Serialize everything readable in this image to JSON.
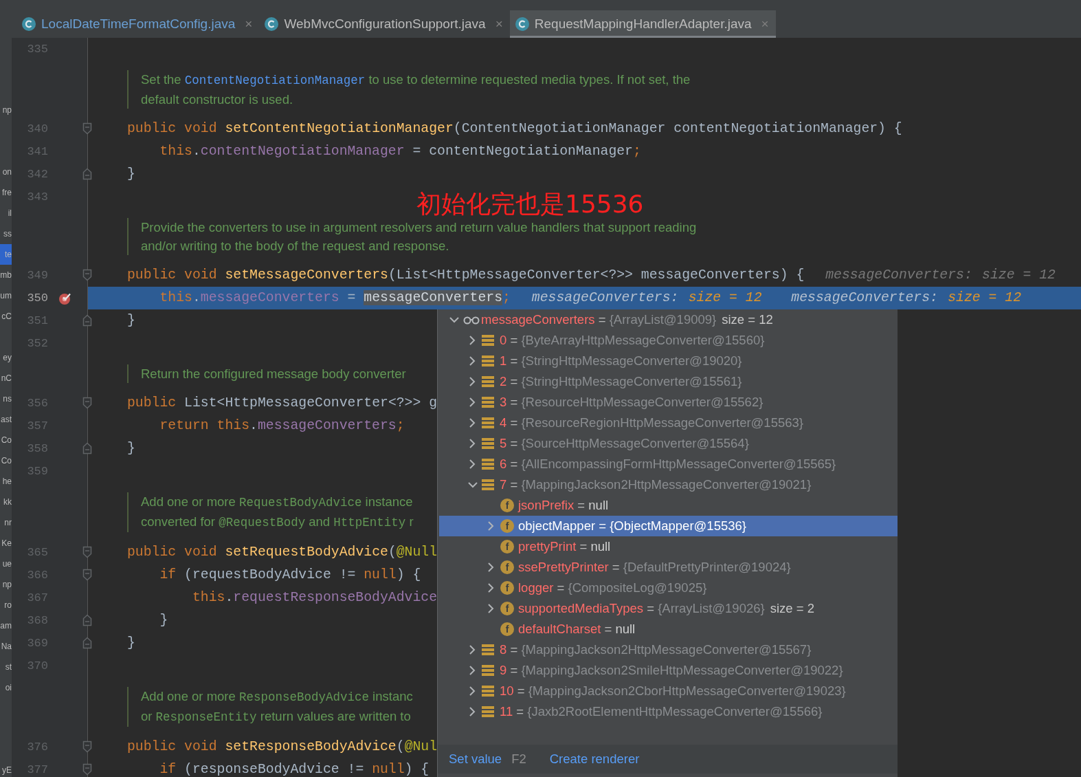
{
  "tabs": [
    {
      "label": "LocalDateTimeFormatConfig.java",
      "close": "×",
      "selected": false,
      "modified": true
    },
    {
      "label": "WebMvcConfigurationSupport.java",
      "close": "×",
      "selected": false,
      "modified": false
    },
    {
      "label": "RequestMappingHandlerAdapter.java",
      "close": "×",
      "selected": true,
      "modified": false
    }
  ],
  "project_panel": [
    {
      "kind": "spacer"
    },
    {
      "kind": "spacer"
    },
    {
      "kind": "spacer"
    },
    {
      "kind": "text",
      "text": "np",
      "selected": false
    },
    {
      "kind": "spacer"
    },
    {
      "kind": "spacer"
    },
    {
      "kind": "text",
      "text": "on",
      "selected": false
    },
    {
      "kind": "text",
      "text": "fre",
      "selected": false
    },
    {
      "kind": "text",
      "text": "il",
      "selected": false
    },
    {
      "kind": "text",
      "text": "ss",
      "selected": false
    },
    {
      "kind": "text",
      "text": "te",
      "selected": true
    },
    {
      "kind": "text",
      "text": "mb",
      "selected": false
    },
    {
      "kind": "text",
      "text": "um",
      "selected": false
    },
    {
      "kind": "text",
      "text": "cC",
      "selected": false
    },
    {
      "kind": "spacer"
    },
    {
      "kind": "text",
      "text": "ey",
      "selected": false
    },
    {
      "kind": "text",
      "text": "nC",
      "selected": false
    },
    {
      "kind": "text",
      "text": "ns",
      "selected": false
    },
    {
      "kind": "text",
      "text": "ast",
      "selected": false
    },
    {
      "kind": "text",
      "text": "Co",
      "selected": false
    },
    {
      "kind": "text",
      "text": "Co",
      "selected": false
    },
    {
      "kind": "text",
      "text": "he",
      "selected": false
    },
    {
      "kind": "text",
      "text": "kk",
      "selected": false
    },
    {
      "kind": "text",
      "text": "nr",
      "selected": false
    },
    {
      "kind": "text",
      "text": "Ke",
      "selected": false
    },
    {
      "kind": "text",
      "text": "ue",
      "selected": false
    },
    {
      "kind": "text",
      "text": "np",
      "selected": false
    },
    {
      "kind": "text",
      "text": "ro",
      "selected": false
    },
    {
      "kind": "text",
      "text": "am",
      "selected": false
    },
    {
      "kind": "text",
      "text": "Na",
      "selected": false
    },
    {
      "kind": "text",
      "text": "st",
      "selected": false
    },
    {
      "kind": "text",
      "text": "oi",
      "selected": false
    },
    {
      "kind": "spacer"
    },
    {
      "kind": "spacer"
    },
    {
      "kind": "spacer"
    },
    {
      "kind": "text",
      "text": "yE",
      "selected": false
    }
  ],
  "editor": {
    "annotation": "初始化完也是15536",
    "lines": [
      {
        "kind": "code",
        "number": "335",
        "fold_start": false,
        "fold_end": false,
        "current": false,
        "breakpoint": false
      },
      {
        "kind": "doc",
        "lines": [
          {
            "segments": [
              {
                "text": "Set the ",
                "kind": "text"
              },
              {
                "text": "ContentNegotiationManager",
                "kind": "link"
              },
              {
                "text": " to use to determine requested media types. If not set, the",
                "kind": "text"
              }
            ]
          },
          {
            "segments": [
              {
                "text": "default constructor is used.",
                "kind": "text"
              }
            ]
          }
        ]
      },
      {
        "kind": "code",
        "number": "340",
        "fold_start": true,
        "fold_end": false,
        "current": false,
        "breakpoint": false,
        "tokens": [
          {
            "text": "public void ",
            "kind": "keyword"
          },
          {
            "text": "setContentNegotiationManager",
            "kind": "method"
          },
          {
            "text": "(ContentNegotiationManager contentNegotiationManager) {",
            "kind": "plain"
          }
        ]
      },
      {
        "kind": "code",
        "number": "341",
        "fold_start": false,
        "fold_end": false,
        "current": false,
        "breakpoint": false,
        "tokens": [
          {
            "text": "    this",
            "kind": "keyword"
          },
          {
            "text": ".",
            "kind": "plain"
          },
          {
            "text": "contentNegotiationManager",
            "kind": "field"
          },
          {
            "text": " = contentNegotiationManager",
            "kind": "plain"
          },
          {
            "text": ";",
            "kind": "keyword"
          }
        ]
      },
      {
        "kind": "code",
        "number": "342",
        "fold_start": false,
        "fold_end": true,
        "current": false,
        "breakpoint": false,
        "tokens": [
          {
            "text": "}",
            "kind": "plain"
          }
        ]
      },
      {
        "kind": "code",
        "number": "343",
        "fold_start": false,
        "fold_end": false,
        "current": false,
        "breakpoint": false
      },
      {
        "kind": "doc",
        "lines": [
          {
            "segments": [
              {
                "text": "Provide the converters to use in argument resolvers and return value handlers that support reading",
                "kind": "text"
              }
            ]
          },
          {
            "segments": [
              {
                "text": "and/or writing to the body of the request and response.",
                "kind": "text"
              }
            ]
          }
        ]
      },
      {
        "kind": "code",
        "number": "349",
        "fold_start": true,
        "fold_end": false,
        "current": false,
        "breakpoint": false,
        "tokens": [
          {
            "text": "public void ",
            "kind": "keyword"
          },
          {
            "text": "setMessageConverters",
            "kind": "method"
          },
          {
            "text": "(List<HttpMessageConverter<?>> messageConverters) {",
            "kind": "plain"
          }
        ],
        "hints": [
          {
            "label": "messageConverters:",
            "value": "size = 12"
          }
        ]
      },
      {
        "kind": "code",
        "number": "350",
        "fold_start": false,
        "fold_end": false,
        "current": true,
        "breakpoint": true,
        "tokens": [
          {
            "text": "    this",
            "kind": "keyword"
          },
          {
            "text": ".",
            "kind": "plain"
          },
          {
            "text": "messageConverters",
            "kind": "field"
          },
          {
            "text": " = ",
            "kind": "plain"
          },
          {
            "text": "messageConverters",
            "kind": "selection"
          },
          {
            "text": ";",
            "kind": "keyword"
          }
        ],
        "hints": [
          {
            "label": "messageConverters:",
            "value": "size = 12"
          },
          {
            "label": "messageConverters:",
            "value": "size = 12"
          }
        ]
      },
      {
        "kind": "code",
        "number": "351",
        "fold_start": false,
        "fold_end": true,
        "current": false,
        "breakpoint": false,
        "tokens": [
          {
            "text": "}",
            "kind": "plain"
          }
        ]
      },
      {
        "kind": "code",
        "number": "352",
        "fold_start": false,
        "fold_end": false,
        "current": false,
        "breakpoint": false
      },
      {
        "kind": "doc",
        "lines": [
          {
            "segments": [
              {
                "text": "Return the configured message body converter",
                "kind": "text"
              }
            ]
          }
        ]
      },
      {
        "kind": "code",
        "number": "356",
        "fold_start": true,
        "fold_end": false,
        "current": false,
        "breakpoint": false,
        "tokens": [
          {
            "text": "public ",
            "kind": "keyword"
          },
          {
            "text": "List<HttpMessageConverter<?>> g",
            "kind": "plain"
          }
        ]
      },
      {
        "kind": "code",
        "number": "357",
        "fold_start": false,
        "fold_end": false,
        "current": false,
        "breakpoint": false,
        "tokens": [
          {
            "text": "    return this",
            "kind": "keyword"
          },
          {
            "text": ".",
            "kind": "plain"
          },
          {
            "text": "messageConverters",
            "kind": "field"
          },
          {
            "text": ";",
            "kind": "keyword"
          }
        ]
      },
      {
        "kind": "code",
        "number": "358",
        "fold_start": false,
        "fold_end": true,
        "current": false,
        "breakpoint": false,
        "tokens": [
          {
            "text": "}",
            "kind": "plain"
          }
        ]
      },
      {
        "kind": "code",
        "number": "359",
        "fold_start": false,
        "fold_end": false,
        "current": false,
        "breakpoint": false
      },
      {
        "kind": "doc",
        "lines": [
          {
            "segments": [
              {
                "text": "Add one or more ",
                "kind": "text"
              },
              {
                "text": "RequestBodyAdvice",
                "kind": "code"
              },
              {
                "text": " instance",
                "kind": "text"
              }
            ]
          },
          {
            "segments": [
              {
                "text": "converted for ",
                "kind": "text"
              },
              {
                "text": "@RequestBody",
                "kind": "code"
              },
              {
                "text": " and ",
                "kind": "text"
              },
              {
                "text": "HttpEntity",
                "kind": "code"
              },
              {
                "text": " r",
                "kind": "text"
              }
            ]
          }
        ]
      },
      {
        "kind": "code",
        "number": "365",
        "fold_start": true,
        "fold_end": false,
        "current": false,
        "breakpoint": false,
        "tokens": [
          {
            "text": "public void ",
            "kind": "keyword"
          },
          {
            "text": "setRequestBodyAdvice",
            "kind": "method"
          },
          {
            "text": "(",
            "kind": "plain"
          },
          {
            "text": "@Null",
            "kind": "annotation"
          }
        ]
      },
      {
        "kind": "code",
        "number": "366",
        "fold_start": true,
        "fold_end": false,
        "current": false,
        "breakpoint": false,
        "tokens": [
          {
            "text": "    if ",
            "kind": "keyword"
          },
          {
            "text": "(requestBodyAdvice != ",
            "kind": "plain"
          },
          {
            "text": "null",
            "kind": "keyword"
          },
          {
            "text": ") {",
            "kind": "plain"
          }
        ]
      },
      {
        "kind": "code",
        "number": "367",
        "fold_start": false,
        "fold_end": false,
        "current": false,
        "breakpoint": false,
        "tokens": [
          {
            "text": "        this",
            "kind": "keyword"
          },
          {
            "text": ".",
            "kind": "plain"
          },
          {
            "text": "requestResponseBodyAdvice",
            "kind": "field"
          }
        ]
      },
      {
        "kind": "code",
        "number": "368",
        "fold_start": false,
        "fold_end": true,
        "current": false,
        "breakpoint": false,
        "tokens": [
          {
            "text": "    }",
            "kind": "plain"
          }
        ]
      },
      {
        "kind": "code",
        "number": "369",
        "fold_start": false,
        "fold_end": true,
        "current": false,
        "breakpoint": false,
        "tokens": [
          {
            "text": "}",
            "kind": "plain"
          }
        ]
      },
      {
        "kind": "code",
        "number": "370",
        "fold_start": false,
        "fold_end": false,
        "current": false,
        "breakpoint": false
      },
      {
        "kind": "doc",
        "lines": [
          {
            "segments": [
              {
                "text": "Add one or more ",
                "kind": "text"
              },
              {
                "text": "ResponseBodyAdvice",
                "kind": "code"
              },
              {
                "text": " instanc",
                "kind": "text"
              }
            ]
          },
          {
            "segments": [
              {
                "text": "or ",
                "kind": "text"
              },
              {
                "text": "ResponseEntity",
                "kind": "code"
              },
              {
                "text": " return values are written to",
                "kind": "text"
              }
            ]
          }
        ]
      },
      {
        "kind": "code",
        "number": "376",
        "fold_start": true,
        "fold_end": false,
        "current": false,
        "breakpoint": false,
        "tokens": [
          {
            "text": "public void ",
            "kind": "keyword"
          },
          {
            "text": "setResponseBodyAdvice",
            "kind": "method"
          },
          {
            "text": "(",
            "kind": "plain"
          },
          {
            "text": "@Nul",
            "kind": "annotation"
          }
        ]
      },
      {
        "kind": "code",
        "number": "377",
        "fold_start": true,
        "fold_end": false,
        "current": false,
        "breakpoint": false,
        "tokens": [
          {
            "text": "    if ",
            "kind": "keyword"
          },
          {
            "text": "(responseBodyAdvice != ",
            "kind": "plain"
          },
          {
            "text": "null",
            "kind": "keyword"
          },
          {
            "text": ") {",
            "kind": "plain"
          }
        ]
      }
    ]
  },
  "popup": {
    "tree": [
      {
        "name": "messageConverters",
        "separator": "=",
        "value": "{ArrayList@19009}",
        "is_null": false,
        "extra": "size = 12",
        "kind": "watch",
        "expanded": true,
        "selected": false,
        "children": [
          {
            "name": "0",
            "separator": "=",
            "value": "{ByteArrayHttpMessageConverter@15560}",
            "is_null": false,
            "kind": "element",
            "expanded": false,
            "selected": false
          },
          {
            "name": "1",
            "separator": "=",
            "value": "{StringHttpMessageConverter@19020}",
            "is_null": false,
            "kind": "element",
            "expanded": false,
            "selected": false
          },
          {
            "name": "2",
            "separator": "=",
            "value": "{StringHttpMessageConverter@15561}",
            "is_null": false,
            "kind": "element",
            "expanded": false,
            "selected": false
          },
          {
            "name": "3",
            "separator": "=",
            "value": "{ResourceHttpMessageConverter@15562}",
            "is_null": false,
            "kind": "element",
            "expanded": false,
            "selected": false
          },
          {
            "name": "4",
            "separator": "=",
            "value": "{ResourceRegionHttpMessageConverter@15563}",
            "is_null": false,
            "kind": "element",
            "expanded": false,
            "selected": false
          },
          {
            "name": "5",
            "separator": "=",
            "value": "{SourceHttpMessageConverter@15564}",
            "is_null": false,
            "kind": "element",
            "expanded": false,
            "selected": false
          },
          {
            "name": "6",
            "separator": "=",
            "value": "{AllEncompassingFormHttpMessageConverter@15565}",
            "is_null": false,
            "kind": "element",
            "expanded": false,
            "selected": false
          },
          {
            "name": "7",
            "separator": "=",
            "value": "{MappingJackson2HttpMessageConverter@19021}",
            "is_null": false,
            "kind": "element",
            "expanded": true,
            "selected": false,
            "children": [
              {
                "name": "jsonPrefix",
                "separator": "=",
                "value": "null",
                "is_null": true,
                "kind": "field",
                "badge": "f",
                "selected": false
              },
              {
                "name": "objectMapper",
                "separator": "=",
                "value": "{ObjectMapper@15536}",
                "is_null": false,
                "kind": "field",
                "badge": "f",
                "expanded": false,
                "selected": true
              },
              {
                "name": "prettyPrint",
                "separator": "=",
                "value": "null",
                "is_null": true,
                "kind": "field",
                "badge": "f",
                "selected": false
              },
              {
                "name": "ssePrettyPrinter",
                "separator": "=",
                "value": "{DefaultPrettyPrinter@19024}",
                "is_null": false,
                "kind": "field",
                "badge": "f",
                "expanded": false,
                "selected": false
              },
              {
                "name": "logger",
                "separator": "=",
                "value": "{CompositeLog@19025}",
                "is_null": false,
                "kind": "field",
                "badge": "f",
                "expanded": false,
                "selected": false
              },
              {
                "name": "supportedMediaTypes",
                "separator": "=",
                "value": "{ArrayList@19026}",
                "is_null": false,
                "extra": "size = 2",
                "kind": "field",
                "badge": "f",
                "expanded": false,
                "selected": false
              },
              {
                "name": "defaultCharset",
                "separator": "=",
                "value": "null",
                "is_null": true,
                "kind": "field",
                "badge": "f",
                "selected": false
              }
            ]
          },
          {
            "name": "8",
            "separator": "=",
            "value": "{MappingJackson2HttpMessageConverter@15567}",
            "is_null": false,
            "kind": "element",
            "expanded": false,
            "selected": false
          },
          {
            "name": "9",
            "separator": "=",
            "value": "{MappingJackson2SmileHttpMessageConverter@19022}",
            "is_null": false,
            "kind": "element",
            "expanded": false,
            "selected": false
          },
          {
            "name": "10",
            "separator": "=",
            "value": "{MappingJackson2CborHttpMessageConverter@19023}",
            "is_null": false,
            "kind": "element",
            "expanded": false,
            "selected": false
          },
          {
            "name": "11",
            "separator": "=",
            "value": "{Jaxb2RootElementHttpMessageConverter@15566}",
            "is_null": false,
            "kind": "element",
            "expanded": false,
            "selected": false
          }
        ]
      }
    ],
    "footer": [
      {
        "text": "Set value",
        "kind": "link"
      },
      {
        "text": "F2",
        "kind": "shortcut"
      },
      {
        "text": "Create renderer",
        "kind": "link"
      }
    ]
  }
}
